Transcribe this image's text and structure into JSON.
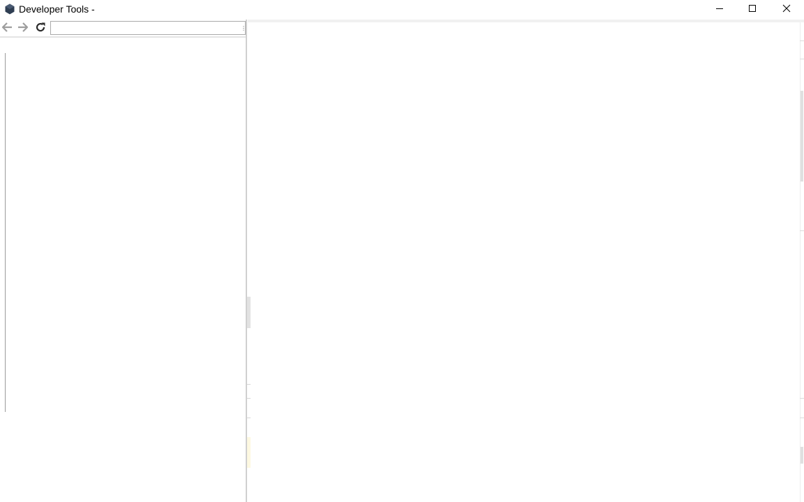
{
  "window": {
    "title": "Developer Tools -",
    "app_icon": "hexagon-app-icon",
    "controls": {
      "minimize_icon": "minimize-icon",
      "maximize_icon": "maximize-icon",
      "close_icon": "close-icon"
    }
  },
  "toolbar": {
    "back_icon": "arrow-left-icon",
    "forward_icon": "arrow-right-icon",
    "reload_icon": "reload-icon",
    "url_value": "",
    "url_placeholder": ""
  },
  "colors": {
    "background": "#ffffff",
    "icon_dark": "#2b2b2b",
    "icon_disabled": "#9e9e9e",
    "splitter": "#d0d0d0",
    "app_icon": "#2f3e52"
  }
}
